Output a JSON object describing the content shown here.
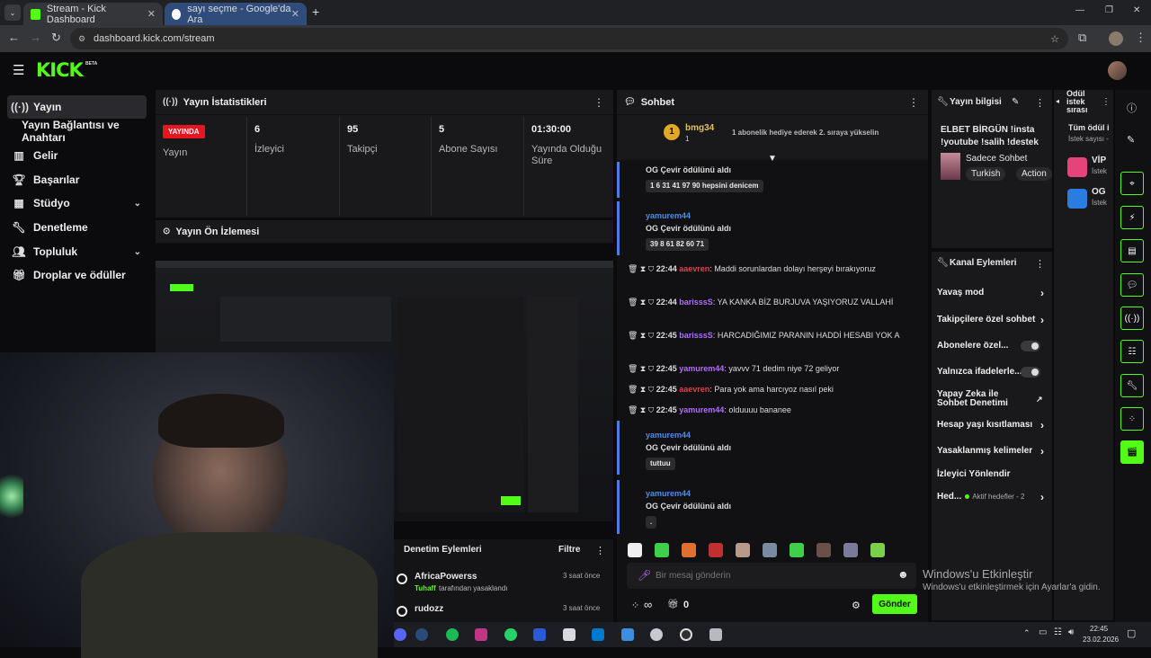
{
  "browser": {
    "tabs": [
      {
        "label": "Stream - Kick Dashboard"
      },
      {
        "label": "sayı seçme - Google'da Ara"
      }
    ],
    "url": "dashboard.kick.com/stream",
    "new_tab": "+"
  },
  "header": {
    "logo": "KICK",
    "badge": "BETA"
  },
  "sidebar": {
    "items": [
      {
        "label": "Yayın",
        "icon": "broadcast-icon"
      },
      {
        "label": "Yayın Bağlantısı ve Anahtarı",
        "icon": ""
      },
      {
        "label": "Gelir",
        "icon": "chart-icon"
      },
      {
        "label": "Başarılar",
        "icon": "trophy-icon"
      },
      {
        "label": "Stüdyo",
        "icon": "studio-icon"
      },
      {
        "label": "Denetleme",
        "icon": "wrench-icon"
      },
      {
        "label": "Topluluk",
        "icon": "users-icon"
      },
      {
        "label": "Droplar ve ödüller",
        "icon": "gift-icon"
      }
    ]
  },
  "stats": {
    "title": "Yayın İstatistikleri",
    "live_badge": "YAYINDA",
    "live_label": "Yayın",
    "cells": [
      {
        "value": "6",
        "label": "İzleyici"
      },
      {
        "value": "95",
        "label": "Takipçi"
      },
      {
        "value": "5",
        "label": "Abone Sayısı"
      },
      {
        "value": "01:30:00",
        "label": "Yayında Olduğu Süre"
      }
    ]
  },
  "preview": {
    "title": "Yayın Ön İzlemesi"
  },
  "moderation": {
    "title": "Denetim Eylemleri",
    "filter": "Filtre",
    "items": [
      {
        "user": "AfricaPowerss",
        "time": "3 saat önce",
        "by": "Tuhaff",
        "action": "tarafından yasaklandı"
      },
      {
        "user": "rudozz",
        "time": "3 saat önce"
      }
    ]
  },
  "chat": {
    "title": "Sohbet",
    "pinned": {
      "rank": "1",
      "user": "bmg34",
      "count": "1",
      "text": "1 abonelik hediye ederek 2. sıraya yükselin"
    },
    "messages": [
      {
        "kind": "reward",
        "reward": "OG Çevir ödülünü aldı",
        "content": "1 6 31 41 97 90 hepsini denicem"
      },
      {
        "kind": "reward",
        "user": "yamurem44",
        "reward": "OG Çevir ödülünü aldı",
        "content": "39 8 61 82 60 71"
      },
      {
        "kind": "msg",
        "time": "22:44",
        "user": "aaevren",
        "text": ": Maddi sorunlardan dolayı herşeyi bırakıyoruz"
      },
      {
        "kind": "msg",
        "time": "22:44",
        "user": "barisssS",
        "text": ": YA KANKA BİZ BURJUVA YAŞIYORUZ VALLAHİ"
      },
      {
        "kind": "msg",
        "time": "22:45",
        "user": "barisssS",
        "text": ": HARCADIĞIMIZ PARANIN HADDİ HESABI YOK A"
      },
      {
        "kind": "msg",
        "time": "22:45",
        "user": "yamurem44",
        "text": ": yavvv 71 dedim niye 72 geliyor"
      },
      {
        "kind": "msg",
        "time": "22:45",
        "user": "aaevren",
        "text": ": Para yok ama harcıyoz nasıl peki"
      },
      {
        "kind": "msg",
        "time": "22:45",
        "user": "yamurem44",
        "text": ": olduuuu bananee"
      },
      {
        "kind": "reward",
        "user": "yamurem44",
        "reward": "OG Çevir ödülünü aldı",
        "content": "tuttuu"
      },
      {
        "kind": "reward",
        "user": "yamurem44",
        "reward": "OG Çevir ödülünü aldı",
        "content": "."
      }
    ],
    "input_placeholder": "Bir mesaj gönderin",
    "points": "∞",
    "count": "0",
    "send": "Gönder"
  },
  "stream_info": {
    "title": "Yayın bilgisi",
    "stream_title": "ELBET BİRGÜN !insta !youtube !salih !destek",
    "category": "Sadece Sohbet",
    "tags": [
      "Turkish",
      "Action"
    ]
  },
  "channel_actions": {
    "title": "Kanal Eylemleri",
    "items": [
      {
        "label": "Yavaş mod",
        "type": "chevron"
      },
      {
        "label": "Takipçilere özel sohbet",
        "type": "chevron"
      },
      {
        "label": "Abonelere özel...",
        "type": "toggle"
      },
      {
        "label": "Yalnızca ifadelerle...",
        "type": "toggle"
      },
      {
        "label": "Yapay Zeka ile Sohbet Denetimi",
        "type": "external"
      },
      {
        "label": "Hesap yaşı kısıtlaması",
        "type": "chevron"
      },
      {
        "label": "Yasaklanmış kelimeler",
        "type": "chevron"
      },
      {
        "label": "İzleyici Yönlendir",
        "type": "none"
      },
      {
        "label": "Hed...",
        "sub": "Aktif hedefler - 2",
        "type": "chevron"
      }
    ]
  },
  "reward_queue": {
    "title": "Ödül istek sırası",
    "filter": "Tüm ödül i",
    "sub": "İstek sayısı -",
    "items": [
      {
        "label": "VİP",
        "sub": "İstek"
      },
      {
        "label": "OG",
        "sub": "İstek"
      }
    ]
  },
  "windows": {
    "activate": "Windows'u Etkinleştir",
    "activate_sub": "Windows'u etkinleştirmek için Ayarlar'a gidin.",
    "time": "22:45",
    "date": "23.02.2026"
  },
  "colors": {
    "accent": "#53fc18",
    "live": "#e8141e",
    "panel": "#19191b",
    "name_blue": "#4a8fe8",
    "name_red": "#e0434b",
    "name_purple": "#b46cff",
    "name_teal": "#34c4c4"
  }
}
